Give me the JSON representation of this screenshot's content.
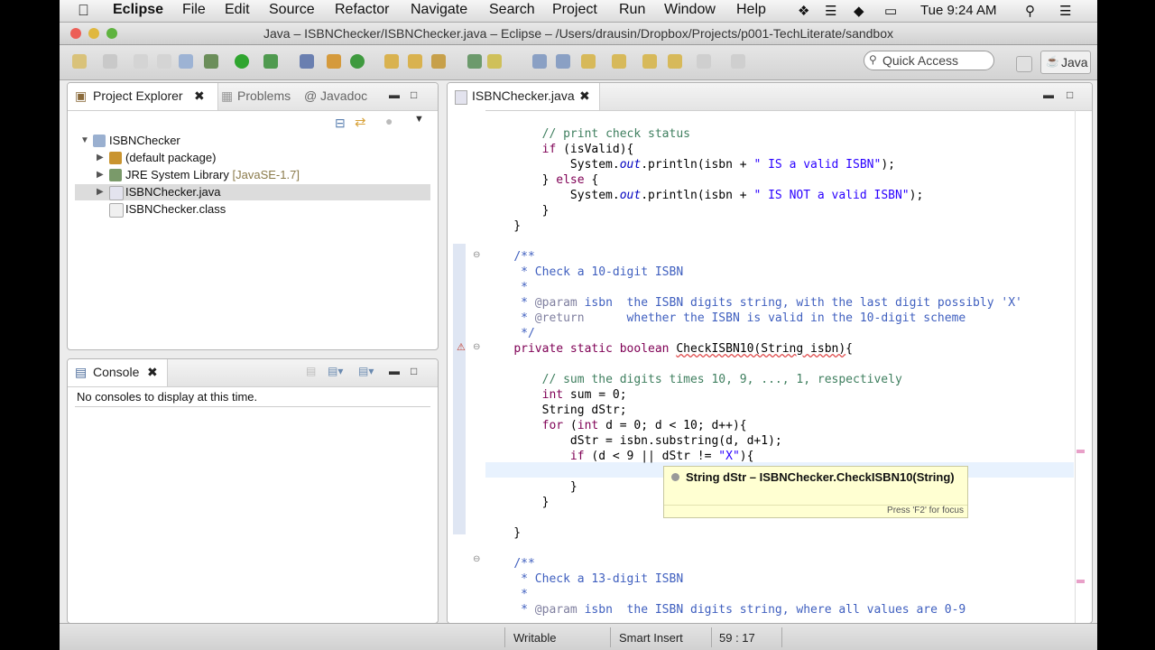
{
  "menubar": {
    "app_name": "Eclipse",
    "items": [
      "File",
      "Edit",
      "Source",
      "Refactor",
      "Navigate",
      "Search",
      "Project",
      "Run",
      "Window",
      "Help"
    ],
    "clock": "Tue 9:24 AM"
  },
  "window": {
    "title": "Java – ISBNChecker/ISBNChecker.java – Eclipse – /Users/drausin/Dropbox/Projects/p001-TechLiterate/sandbox"
  },
  "toolbar": {
    "quick_access_placeholder": "Quick Access",
    "perspective": "Java"
  },
  "project_explorer": {
    "tabs": [
      "Project Explorer",
      "Problems",
      "Javadoc"
    ],
    "tree": [
      {
        "label": "ISBNChecker",
        "level": 0,
        "expanded": true
      },
      {
        "label": "(default package)",
        "level": 1
      },
      {
        "label": "JRE System Library",
        "suffix": "[JavaSE-1.7]",
        "level": 1
      },
      {
        "label": "ISBNChecker.java",
        "level": 1,
        "selected": true
      },
      {
        "label": "ISBNChecker.class",
        "level": 1
      }
    ]
  },
  "console": {
    "tab": "Console",
    "message": "No consoles to display at this time."
  },
  "editor": {
    "tab": "ISBNChecker.java",
    "tooltip_title": "String dStr – ISBNChecker.CheckISBN10(String)",
    "tooltip_footer": "Press 'F2' for focus"
  },
  "status": {
    "writable": "Writable",
    "insert_mode": "Smart Insert",
    "position": "59 : 17"
  },
  "colors": {
    "keyword": "#7f0055",
    "comment": "#3f7f5f",
    "string": "#2a00ff",
    "javadoc": "#3f5fbf"
  }
}
